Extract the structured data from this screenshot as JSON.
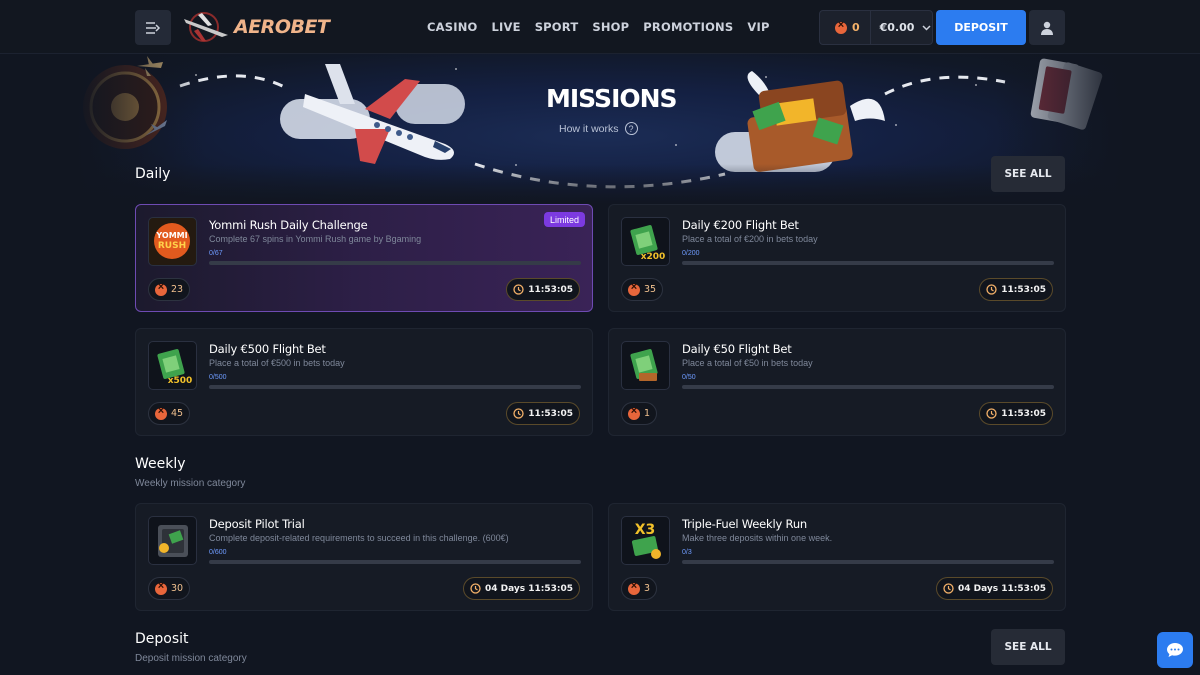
{
  "header": {
    "brand": "AEROBET",
    "nav": [
      "CASINO",
      "LIVE",
      "SPORT",
      "SHOP",
      "PROMOTIONS",
      "VIP"
    ],
    "coins": "0",
    "balance": "€0.00",
    "deposit_label": "DEPOSIT"
  },
  "banner": {
    "title": "MISSIONS",
    "how_it_works": "How it works"
  },
  "sections": {
    "daily": {
      "title": "Daily",
      "see_all": "SEE ALL"
    },
    "weekly": {
      "title": "Weekly",
      "subtitle": "Weekly mission category"
    },
    "deposit": {
      "title": "Deposit",
      "subtitle": "Deposit mission category",
      "see_all": "SEE ALL"
    }
  },
  "missions": [
    {
      "title": "Yommi Rush Daily Challenge",
      "desc": "Complete 67 spins in Yommi Rush game by Bgaming",
      "progress_text": "0/67",
      "progress": 0,
      "reward": "23",
      "timer": "11:53:05",
      "badge": "Limited",
      "thumb_icon": "yommi-rush-icon",
      "thumb_text": "YOMMI RUSH"
    },
    {
      "title": "Daily €200 Flight Bet",
      "desc": "Place a total of €200 in bets today",
      "progress_text": "0/200",
      "progress": 0,
      "reward": "35",
      "timer": "11:53:05",
      "thumb_icon": "cash-stack-icon",
      "thumb_text": "x200"
    },
    {
      "title": "Daily €500 Flight Bet",
      "desc": "Place a total of €500 in bets today",
      "progress_text": "0/500",
      "progress": 0,
      "reward": "45",
      "timer": "11:53:05",
      "thumb_icon": "cash-stack-icon",
      "thumb_text": "x500"
    },
    {
      "title": "Daily €50 Flight Bet",
      "desc": "Place a total of €50 in bets today",
      "progress_text": "0/50",
      "progress": 0,
      "reward": "1",
      "timer": "11:53:05",
      "thumb_icon": "cash-stack-icon",
      "thumb_text": ""
    },
    {
      "title": "Deposit Pilot Trial",
      "desc": "Complete deposit-related requirements to succeed in this challenge. (600€)",
      "progress_text": "0/600",
      "progress": 0,
      "reward": "30",
      "timer": "04 Days 11:53:05",
      "thumb_icon": "safe-icon",
      "thumb_text": ""
    },
    {
      "title": "Triple-Fuel Weekly Run",
      "desc": "Make three deposits within one week.",
      "progress_text": "0/3",
      "progress": 0,
      "reward": "3",
      "timer": "04 Days 11:53:05",
      "thumb_icon": "cash-x3-icon",
      "thumb_text": "X3"
    }
  ],
  "colors": {
    "accent": "#2c7cf0",
    "progress": "#6f9cff",
    "coin": "#e8663b",
    "badge": "#7c3ae0"
  }
}
